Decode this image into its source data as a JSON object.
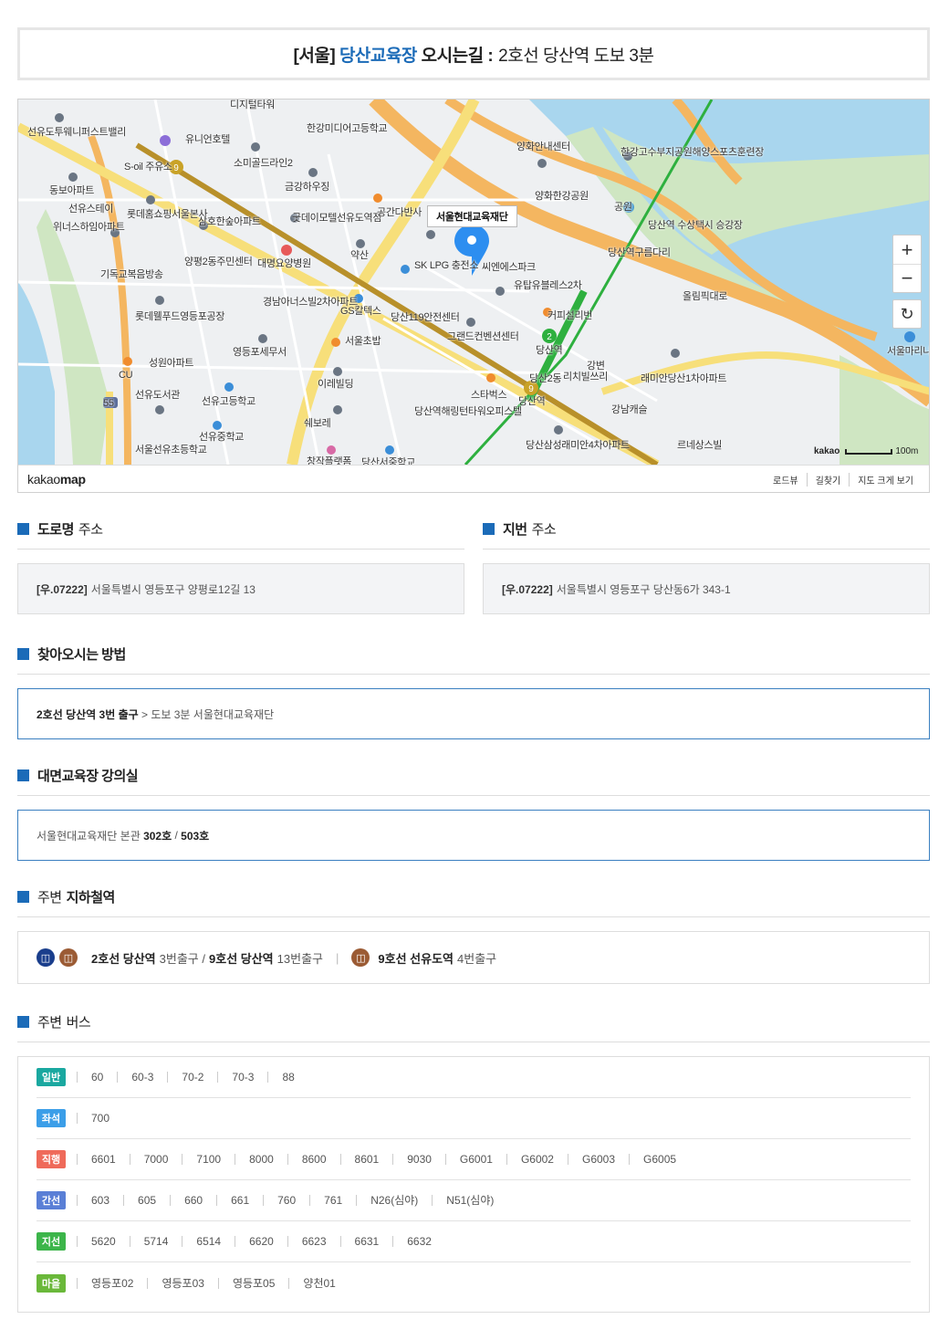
{
  "title": {
    "region": "[서울]",
    "place": "당산교육장",
    "label": "오시는길 :",
    "desc": "2호선 당산역 도보 3분"
  },
  "map": {
    "tooltip": "서울현대교육재단",
    "scale_text": "100m",
    "logo_kakao": "kakao",
    "brand_light": "kakao",
    "brand_bold": "map",
    "links": [
      "로드뷰",
      "길찾기",
      "지도 크게 보기"
    ],
    "zoom_in": "+",
    "zoom_out": "−",
    "refresh_icon": "↻",
    "labels": [
      "선유도투웨니퍼스트밸리",
      "디지털타워",
      "유니언호텔",
      "한강미디어고등학교",
      "S-oil 주유소",
      "소미골드라인2",
      "금강하우징",
      "양화안내센터",
      "한강고수부지공원해양스포츠훈련장",
      "동보아파트",
      "선유스테이",
      "롯데홈쇼핑서울본사",
      "삼호한숲아파트",
      "굿데이모텔선유도역점",
      "공간다반사",
      "양화한강공원",
      "공원",
      "당산역 수상택시 승강장",
      "위너스하임아파트",
      "양평2동주민센터",
      "대명요양병원",
      "약산",
      "SK LPG 충전소",
      "씨엔에스파크",
      "당산역구름다리",
      "기독교복음방송",
      "경남아너스빌2차아파트",
      "유탑유블레스2차",
      "롯데웰푸드영등포공장",
      "GS칼텍스",
      "당산119안전센터",
      "커피설리번",
      "올림픽대로",
      "그랜드컨벤션센터",
      "당산역",
      "서울마리나클럽앤요트",
      "성원아파트",
      "영등포세무서",
      "서울초밥",
      "강변",
      "래미안당산1차아파트",
      "CU",
      "이레빌딩",
      "당산2동",
      "리치빌쓰리",
      "선유도서관",
      "선유고등학교",
      "스타벅스",
      "당산역해링턴타워오피스텔",
      "강남캐슬",
      "쉐보레",
      "선유중학교",
      "당산삼성래미안4차아파트",
      "르네상스빌",
      "서울선유초등학교",
      "창작플랫폼",
      "당산서중학교",
      "당산역",
      "55"
    ]
  },
  "road_address": {
    "heading": "도로명",
    "heading_light": "주소",
    "zip": "[우.07222]",
    "addr": "서울특별시 영등포구 양평로12길 13"
  },
  "lot_address": {
    "heading": "지번",
    "heading_light": "주소",
    "zip": "[우.07222]",
    "addr": "서울특별시 영등포구 당산동6가 343-1"
  },
  "directions": {
    "heading": "찾아오시는 방법",
    "bold": "2호선 당산역 3번 출구",
    "rest": " > 도보 3분 서울현대교육재단"
  },
  "classroom": {
    "heading": "대면교육장 강의실",
    "prefix": "서울현대교육재단 본관 ",
    "room1": "302호",
    "slash": " / ",
    "room2": "503호"
  },
  "subway": {
    "heading": "주변",
    "heading_bold": "지하철역",
    "icon_navy": "metro-icon",
    "icon_brown": "metro-icon",
    "line1": "2호선 당산역",
    "exit1": "3번출구 /",
    "line2": "9호선 당산역",
    "exit2": "13번출구",
    "sep": "|",
    "line3": "9호선 선유도역",
    "exit3": "4번출구"
  },
  "bus": {
    "heading": "주변",
    "heading_bold": "버스",
    "rows": [
      {
        "type": "일반",
        "color": "#1aa8a0",
        "routes": [
          "60",
          "60-3",
          "70-2",
          "70-3",
          "88"
        ]
      },
      {
        "type": "좌석",
        "color": "#3b9ee8",
        "routes": [
          "700"
        ]
      },
      {
        "type": "직행",
        "color": "#ef6a5a",
        "routes": [
          "6601",
          "7000",
          "7100",
          "8000",
          "8600",
          "8601",
          "9030",
          "G6001",
          "G6002",
          "G6003",
          "G6005"
        ]
      },
      {
        "type": "간선",
        "color": "#5a7fd6",
        "routes": [
          "603",
          "605",
          "660",
          "661",
          "760",
          "761",
          "N26(심야)",
          "N51(심야)"
        ]
      },
      {
        "type": "지선",
        "color": "#3cb54a",
        "routes": [
          "5620",
          "5714",
          "6514",
          "6620",
          "6623",
          "6631",
          "6632"
        ]
      },
      {
        "type": "마을",
        "color": "#6ab83a",
        "routes": [
          "영등포02",
          "영등포03",
          "영등포05",
          "양천01"
        ]
      }
    ]
  }
}
